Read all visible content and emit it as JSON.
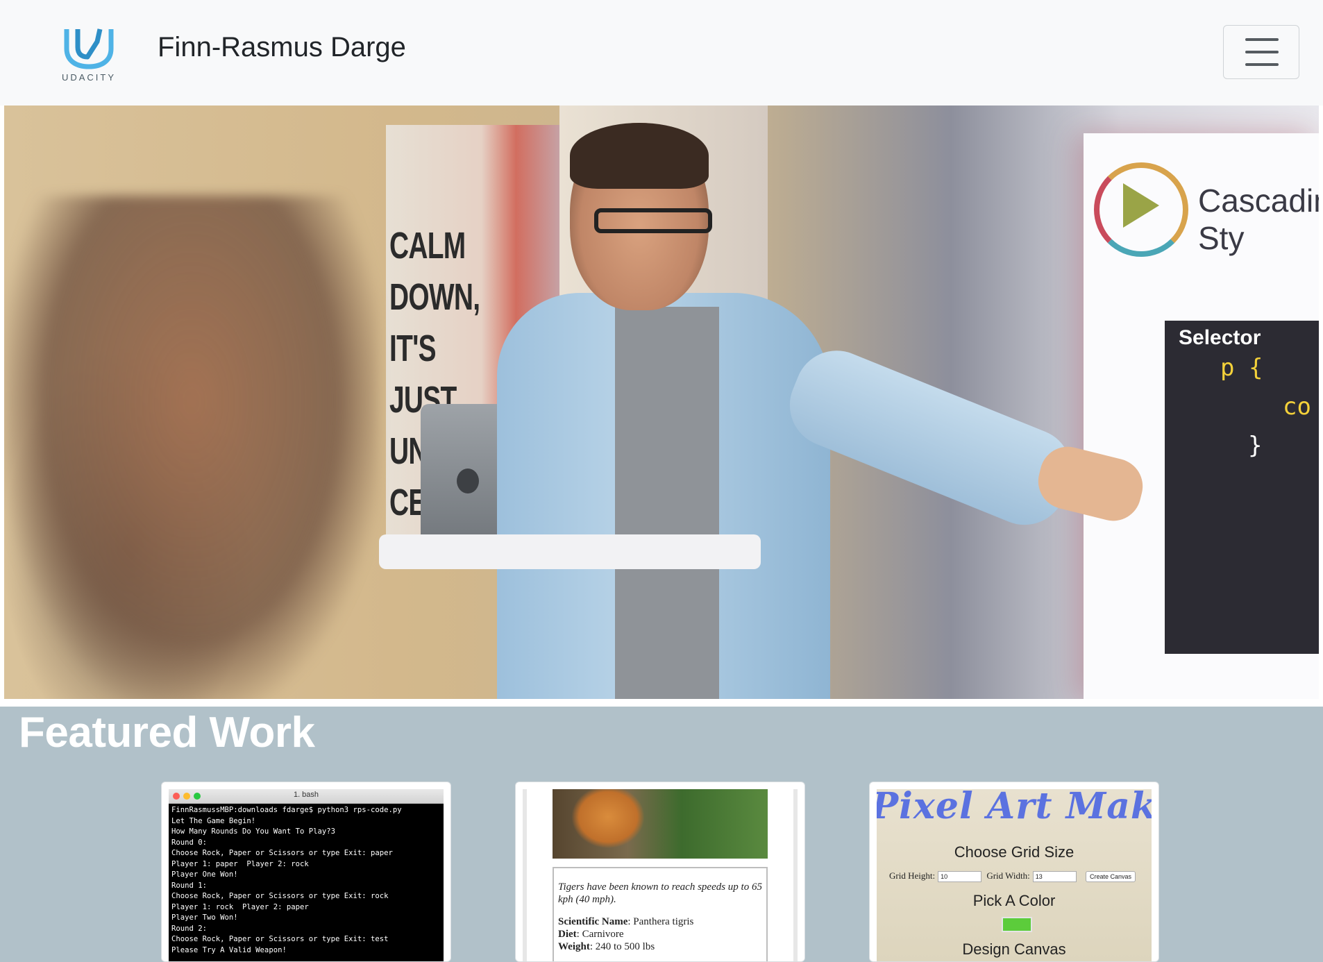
{
  "navbar": {
    "logo_text": "UDACITY",
    "brand": "Finn-Rasmus Darge",
    "toggler_label": "Toggle navigation"
  },
  "hero": {
    "poster_text": "CALM DOWN, IT'S JUST UN- CERTAIN",
    "screen_title": "Cascading Sty",
    "screen_label": "Selector",
    "screen_code": "p {",
    "screen_code2": "co",
    "screen_code3": "}"
  },
  "featured": {
    "title": "Featured Work",
    "terminal": {
      "window_title": "1. bash",
      "lines": [
        "FinnRasmussMBP:downloads fdarge$ python3 rps-code.py",
        "Let The Game Begin!",
        "How Many Rounds Do You Want To Play?3",
        "Round 0:",
        "Choose Rock, Paper or Scissors or type Exit: paper",
        "Player 1: paper  Player 2: rock",
        "Player One Won!",
        "Round 1:",
        "Choose Rock, Paper or Scissors or type Exit: rock",
        "Player 1: rock  Player 2: paper",
        "Player Two Won!",
        "Round 2:",
        "Choose Rock, Paper or Scissors or type Exit: test",
        "Please Try A Valid Weapon!"
      ]
    },
    "tiger": {
      "quote": "Tigers have been known to reach speeds up to 65 kph (40 mph).",
      "sci_label": "Scientific Name",
      "sci_value": ": Panthera tigris",
      "diet_label": "Diet",
      "diet_value": ": Carnivore",
      "weight_label": "Weight",
      "weight_value": ": 240 to 500 lbs"
    },
    "pixel": {
      "title": "Pixel Art Maker",
      "grid_heading": "Choose Grid Size",
      "height_label": "Grid Height:",
      "height_value": "10",
      "width_label": "Grid Width:",
      "width_value": "13",
      "create_button": "Create Canvas",
      "color_heading": "Pick A Color",
      "color_value": "#5ccc3b",
      "canvas_heading": "Design Canvas"
    }
  }
}
